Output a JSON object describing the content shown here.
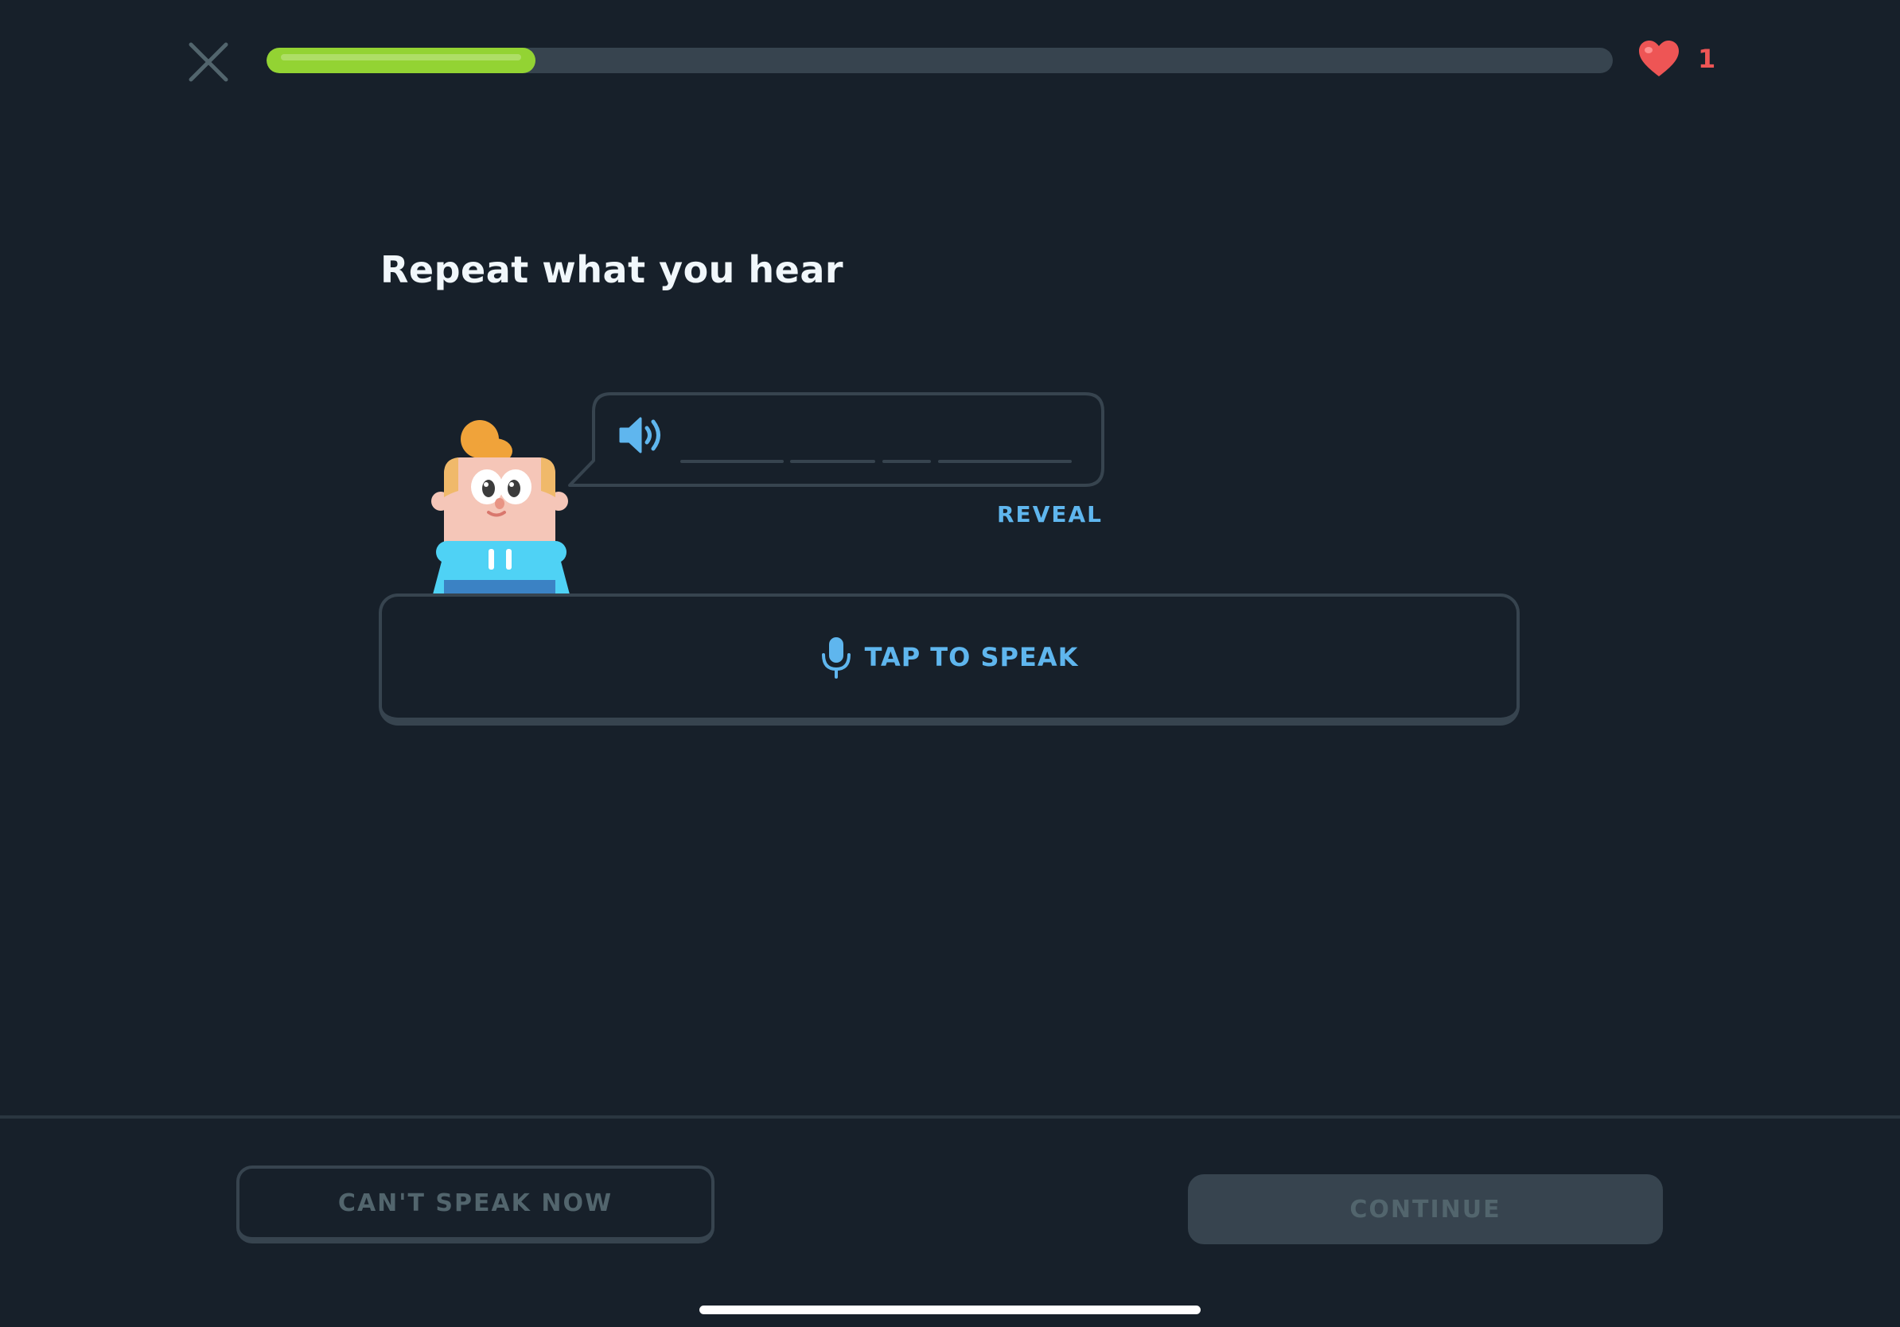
{
  "header": {
    "close_icon": "close-icon",
    "progress": 0.2,
    "hearts_count": "1",
    "heart_icon": "heart-icon"
  },
  "exercise": {
    "title": "Repeat what you hear",
    "speaker_icon": "speaker-icon",
    "reveal_label": "REVEAL",
    "blank_words": 4
  },
  "speak": {
    "mic_icon": "microphone-icon",
    "label": "TAP TO SPEAK"
  },
  "footer": {
    "cant_speak_label": "CAN'T SPEAK NOW",
    "continue_label": "CONTINUE"
  },
  "colors": {
    "background": "#17202a",
    "progress_fill": "#93d333",
    "track": "#37444f",
    "accent_blue": "#5fb6ee",
    "heart": "#ee5555",
    "disabled_text": "#52656d"
  }
}
